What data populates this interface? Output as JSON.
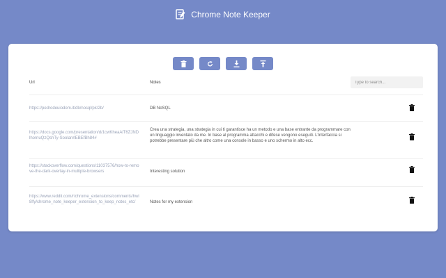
{
  "app": {
    "title": "Chrome Note Keeper"
  },
  "toolbar": {
    "buttons": [
      {
        "icon": "trash-icon"
      },
      {
        "icon": "refresh-icon"
      },
      {
        "icon": "download-icon"
      },
      {
        "icon": "upload-icon"
      }
    ]
  },
  "table": {
    "headers": {
      "url": "Url",
      "notes": "Notes"
    },
    "search_placeholder": "Type to search...",
    "rows": [
      {
        "url": "https://pedrodeuiodom.it/db/nosql/pk/2b/",
        "note": "DB NoSQL"
      },
      {
        "url": "https://docs.google.com/presentation/d/1cwKheaAiT6ZJNDlhornuQzQshTy-SoolanrlEBEfBh84#",
        "note": "Crea una strategia, una strategia in cui ti garantisce ha un metodo e una base entrante da programmare con un linguaggio inventato da me. In base al programma attacchi e difese vengono eseguiti. L'interfaccia si potrebbe presentare più che altro come una console in basso e uno schermo in alto ecc."
      },
      {
        "url": "https://stackoverflow.com/questions/11037576/how-to-remove-the-dark-overlay-in-multiple-browsers",
        "note": "Interesting solution"
      },
      {
        "url": "https://www.reddit.com/r/chrome_extensions/comments/hwi8lfy/chrome_note_keeper_extension_to_keep_notes_etc/",
        "note": "Notes for my extension"
      }
    ]
  },
  "colors": {
    "background": "#7589c8",
    "accent": "#7589c8",
    "card": "#ffffff"
  }
}
